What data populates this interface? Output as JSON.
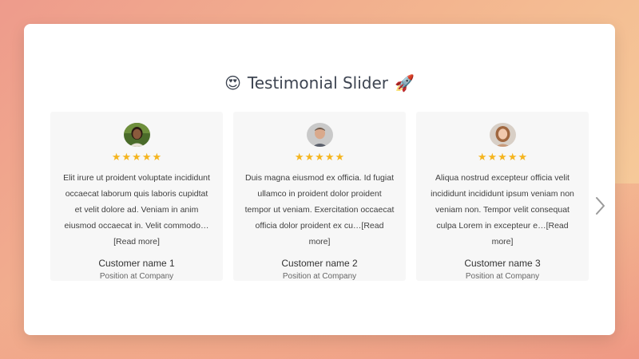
{
  "header": {
    "emoji_left": "😍",
    "title": "Testimonial Slider",
    "emoji_right": "🚀"
  },
  "slider": {
    "next_icon": "chevron-right-icon",
    "testimonials": [
      {
        "avatar": "avatar-photo-1",
        "rating": 5,
        "quote": "Elit irure ut proident voluptate incididunt occaecat laborum quis laboris cupidtat et velit dolore ad. Veniam in anim eiusmod occaecat in. Velit commodo…",
        "read_more": "[Read more]",
        "name": "Customer name 1",
        "position": "Position at Company"
      },
      {
        "avatar": "avatar-photo-2",
        "rating": 5,
        "quote": "Duis magna eiusmod ex officia. Id fugiat ullamco in proident dolor proident tempor ut veniam. Exercitation occaecat officia dolor proident ex cu…",
        "read_more": "[Read more]",
        "name": "Customer name 2",
        "position": "Position at Company"
      },
      {
        "avatar": "avatar-photo-3",
        "rating": 5,
        "quote": "Aliqua nostrud excepteur officia velit incididunt incididunt ipsum veniam non veniam non. Tempor velit consequat culpa Lorem in excepteur e…",
        "read_more": "[Read more]",
        "name": "Customer name 3",
        "position": "Position at Company"
      }
    ]
  },
  "colors": {
    "star": "#f5b51f",
    "card_bg": "#f7f7f7",
    "title_text": "#3d4451"
  }
}
